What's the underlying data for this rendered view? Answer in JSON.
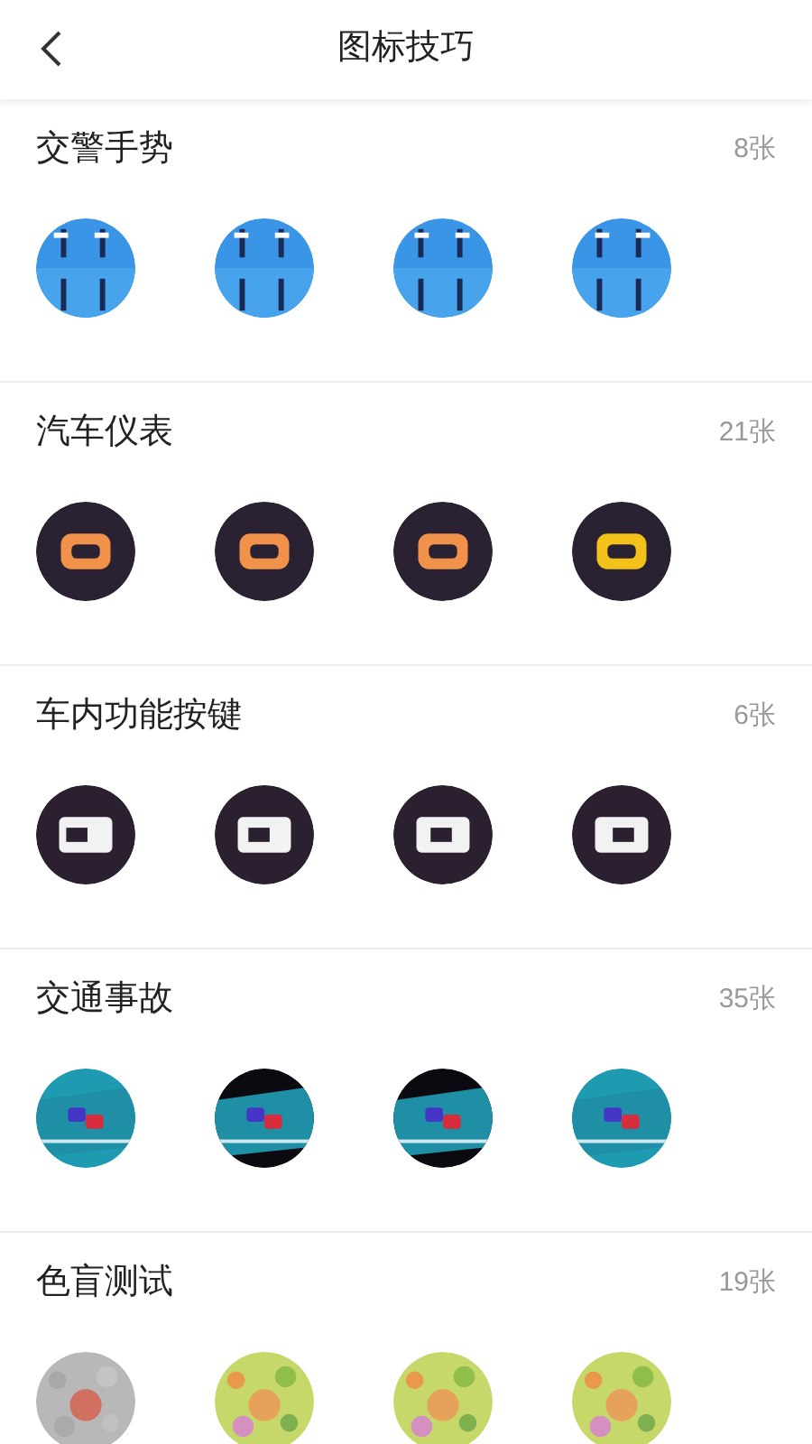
{
  "header": {
    "title": "图标技巧"
  },
  "sections": [
    {
      "title": "交警手势",
      "count": "8张"
    },
    {
      "title": "汽车仪表",
      "count": "21张"
    },
    {
      "title": "车内功能按键",
      "count": "6张"
    },
    {
      "title": "交通事故",
      "count": "35张"
    },
    {
      "title": "色盲测试",
      "count": "19张"
    }
  ]
}
